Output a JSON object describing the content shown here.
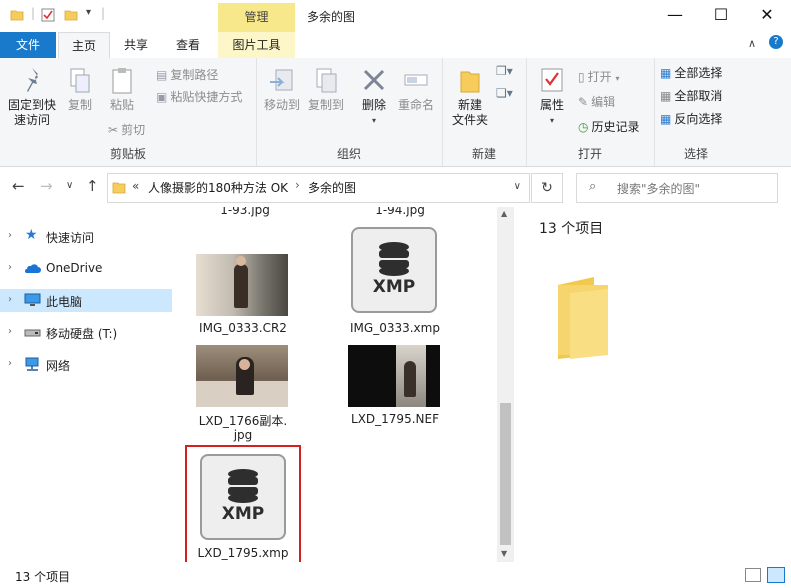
{
  "titlebar": {
    "manage_tab": "管理",
    "title": "多余的图",
    "minimize": "—",
    "maximize": "☐",
    "close": "✕"
  },
  "tabs": {
    "file": "文件",
    "home": "主页",
    "share": "共享",
    "view": "查看",
    "picture_tools": "图片工具"
  },
  "ribbon": {
    "clipboard": {
      "label": "剪贴板",
      "pin": "固定到快\n速访问",
      "pin_line1": "固定到快",
      "pin_line2": "速访问",
      "copy": "复制",
      "paste": "粘贴",
      "copy_path": "复制路径",
      "paste_shortcut": "粘贴快捷方式",
      "cut": "剪切"
    },
    "organize": {
      "label": "组织",
      "move_to": "移动到",
      "copy_to": "复制到",
      "delete": "删除",
      "rename": "重命名"
    },
    "new": {
      "label": "新建",
      "new_folder_line1": "新建",
      "new_folder_line2": "文件夹"
    },
    "open": {
      "label": "打开",
      "properties": "属性",
      "open": "打开",
      "edit": "编辑",
      "history": "历史记录"
    },
    "select": {
      "label": "选择",
      "select_all": "全部选择",
      "select_none": "全部取消",
      "invert": "反向选择"
    }
  },
  "address": {
    "prefix": "«",
    "crumb1": "人像摄影的180种方法 OK",
    "sep": "›",
    "crumb2": "多余的图",
    "search_placeholder": "搜索\"多余的图\""
  },
  "nav": [
    {
      "label": "快速访问"
    },
    {
      "label": "OneDrive"
    },
    {
      "label": "此电脑"
    },
    {
      "label": "移动硬盘 (T:)"
    },
    {
      "label": "网络"
    }
  ],
  "files": {
    "top_partial_left": "1-93.jpg",
    "top_partial_right": "1-94.jpg",
    "f1": "IMG_0333.CR2",
    "f2": "IMG_0333.xmp",
    "f3_line1": "LXD_1766副本.",
    "f3_line2": "jpg",
    "f4": "LXD_1795.NEF",
    "f5": "LXD_1795.xmp",
    "xmp_badge": "XMP"
  },
  "preview": {
    "count_text": "13 个项目"
  },
  "status": {
    "count_text": "13 个项目"
  },
  "colors": {
    "file_tab": "#1979ca",
    "manage_tab": "#f7e98b",
    "selected_nav": "#cce8ff",
    "highlight_box": "#d62020"
  }
}
